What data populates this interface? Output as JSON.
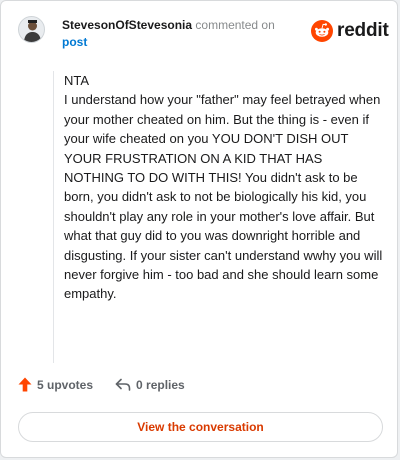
{
  "header": {
    "username": "StevesonOfStevesonia",
    "action_text": "commented on",
    "post_link": "post",
    "logo_word": "reddit"
  },
  "comment": {
    "lines": [
      "NTA",
      "I understand how your \"father\" may feel betrayed when your mother cheated on him. But the thing is - even if your wife cheated on you YOU DON'T DISH OUT YOUR FRUSTRATION ON A KID THAT HAS NOTHING TO DO WITH THIS! You didn't ask to be born, you didn't ask to not be biologically his kid, you shouldn't play any role in your mother's love affair. But what that guy did to you was downright horrible and disgusting. If your sister can't understand wwhy you will never forgive him - too bad and she should learn some empathy."
    ]
  },
  "actions": {
    "upvotes": "5 upvotes",
    "replies": "0 replies"
  },
  "view_button": "View the conversation",
  "colors": {
    "brand_orange": "#ff4500",
    "upvote_orange": "#ff4500",
    "button_text": "#d93a00",
    "link_blue": "#0079d3"
  },
  "icons": {
    "avatar": "user-avatar",
    "logo": "reddit-snoo-icon",
    "upvote": "upvote-arrow-icon",
    "reply": "reply-arrow-icon"
  }
}
